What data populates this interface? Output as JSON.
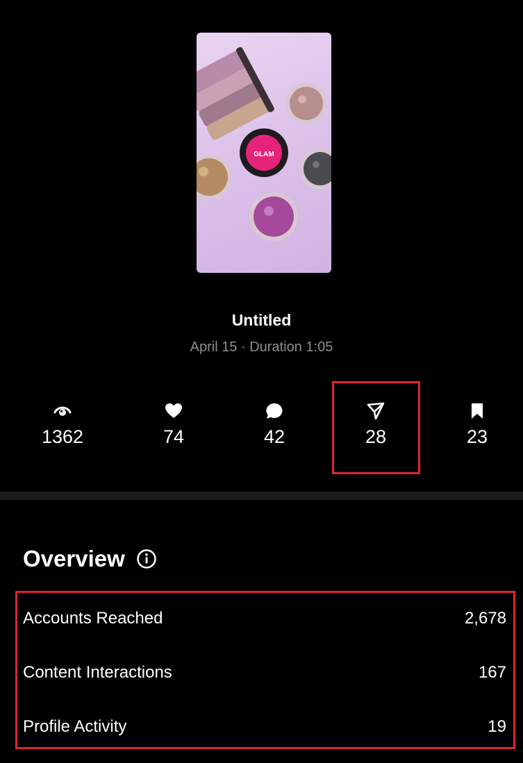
{
  "post": {
    "title": "Untitled",
    "meta": "April 15 · Duration 1:05"
  },
  "stats": [
    {
      "icon": "eye-icon",
      "value": "1362"
    },
    {
      "icon": "heart-icon",
      "value": "74"
    },
    {
      "icon": "comment-icon",
      "value": "42"
    },
    {
      "icon": "send-icon",
      "value": "28"
    },
    {
      "icon": "bookmark-icon",
      "value": "23"
    }
  ],
  "overview": {
    "title": "Overview",
    "metrics": [
      {
        "label": "Accounts Reached",
        "value": "2,678"
      },
      {
        "label": "Content Interactions",
        "value": "167"
      },
      {
        "label": "Profile Activity",
        "value": "19"
      }
    ]
  },
  "colors": {
    "background": "#000000",
    "text": "#ffffff",
    "meta_text": "#8e8e93",
    "divider": "#1c1c1e",
    "highlight": "#e0242f"
  }
}
